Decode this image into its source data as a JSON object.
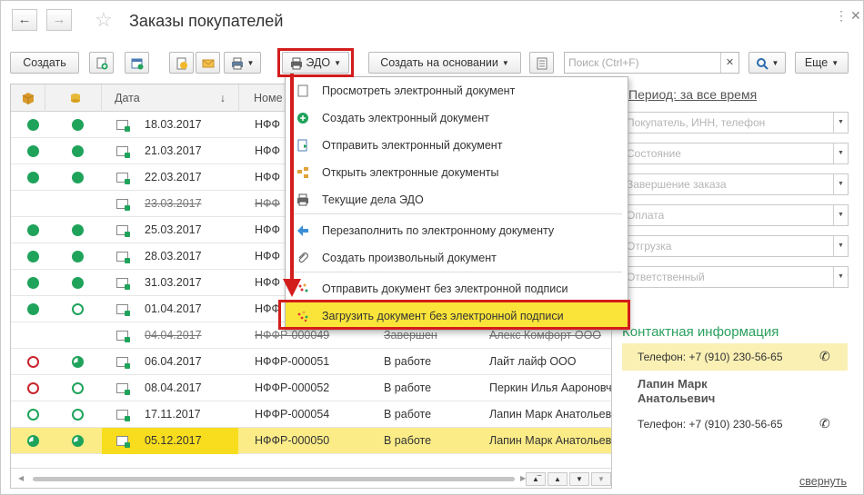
{
  "window": {
    "title": "Заказы покупателей"
  },
  "toolbar": {
    "create": "Создать",
    "edo": "ЭДО",
    "create_based": "Создать на основании",
    "search_placeholder": "Поиск (Ctrl+F)",
    "more": "Еще"
  },
  "table": {
    "headers": {
      "date": "Дата",
      "number": "Номе"
    },
    "rows": [
      {
        "date": "18.03.2017",
        "number": "НФФ",
        "status": "",
        "client": "",
        "c1": "full",
        "c2": "full",
        "strike": false,
        "selected": false
      },
      {
        "date": "21.03.2017",
        "number": "НФФ",
        "status": "",
        "client": "",
        "c1": "full",
        "c2": "full",
        "strike": false,
        "selected": false
      },
      {
        "date": "22.03.2017",
        "number": "НФФ",
        "status": "",
        "client": "",
        "c1": "full",
        "c2": "full",
        "strike": false,
        "selected": false
      },
      {
        "date": "23.03.2017",
        "number": "НФФ",
        "status": "",
        "client": "",
        "c1": "",
        "c2": "",
        "strike": true,
        "selected": false
      },
      {
        "date": "25.03.2017",
        "number": "НФФ",
        "status": "",
        "client": "",
        "c1": "full",
        "c2": "full",
        "strike": false,
        "selected": false
      },
      {
        "date": "28.03.2017",
        "number": "НФФ",
        "status": "",
        "client": "",
        "c1": "full",
        "c2": "full",
        "strike": false,
        "selected": false
      },
      {
        "date": "31.03.2017",
        "number": "НФФ",
        "status": "",
        "client": "",
        "c1": "full",
        "c2": "full",
        "strike": false,
        "selected": false
      },
      {
        "date": "01.04.2017",
        "number": "НФФ",
        "status": "",
        "client": "",
        "c1": "full",
        "c2": "ring-g",
        "strike": false,
        "selected": false
      },
      {
        "date": "04.04.2017",
        "number": "НФФР-000049",
        "status": "Завершен",
        "client": "Алекс Комфорт ООО",
        "c1": "",
        "c2": "",
        "strike": true,
        "selected": false
      },
      {
        "date": "06.04.2017",
        "number": "НФФР-000051",
        "status": "В работе",
        "client": "Лайт лайф ООО",
        "c1": "ring-r",
        "c2": "half",
        "strike": false,
        "selected": false
      },
      {
        "date": "08.04.2017",
        "number": "НФФР-000052",
        "status": "В работе",
        "client": "Перкин Илья Аароновч",
        "c1": "ring-r",
        "c2": "ring-g",
        "strike": false,
        "selected": false
      },
      {
        "date": "17.11.2017",
        "number": "НФФР-000054",
        "status": "В работе",
        "client": "Лапин Марк Анатольев",
        "c1": "ring-g",
        "c2": "ring-g",
        "strike": false,
        "selected": false
      },
      {
        "date": "05.12.2017",
        "number": "НФФР-000050",
        "status": "В работе",
        "client": "Лапин Марк Анатольев",
        "c1": "half",
        "c2": "half",
        "strike": false,
        "selected": true
      }
    ]
  },
  "menu": {
    "items": [
      {
        "label": "Просмотреть электронный документ",
        "icon": "document-icon"
      },
      {
        "label": "Создать электронный документ",
        "icon": "plus-circle-icon"
      },
      {
        "label": "Отправить электронный документ",
        "icon": "send-document-icon"
      },
      {
        "label": "Открыть электронные документы",
        "icon": "open-documents-icon"
      },
      {
        "label": "Текущие дела ЭДО",
        "icon": "edo-tasks-icon"
      },
      {
        "label": "Перезаполнить по электронному документу",
        "icon": "refill-arrow-icon"
      },
      {
        "label": "Создать произвольный документ",
        "icon": "paperclip-icon"
      },
      {
        "label": "Отправить документ без электронной подписи",
        "icon": "send-unsigned-icon"
      },
      {
        "label": "Загрузить документ без электронной подписи",
        "icon": "upload-unsigned-icon"
      }
    ]
  },
  "filters": {
    "period": "Период: за все время",
    "fields": [
      "Покупатель, ИНН, телефон",
      "Состояние",
      "Завершение заказа",
      "Оплата",
      "Отгрузка",
      "Ответственный"
    ]
  },
  "contact": {
    "header": "Контактная информация",
    "phone1": "Телефон: +7 (910) 230-56-65",
    "name_line1": "Лапин Марк",
    "name_line2": "Анатольевич",
    "phone2": "Телефон: +7 (910) 230-56-65"
  },
  "collapse_link": "свернуть",
  "colors": {
    "accent_green": "#1fa35b",
    "highlight": "#d31c1c",
    "selection": "#fbec88"
  }
}
